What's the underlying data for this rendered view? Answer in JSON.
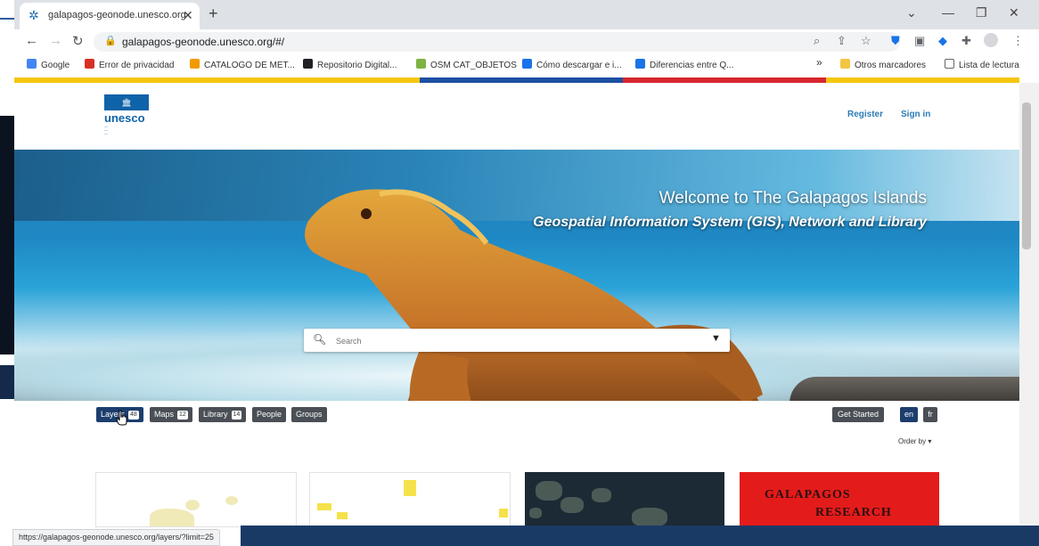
{
  "browser": {
    "tab_title": "galapagos-geonode.unesco.org",
    "new_tab_icon": "+",
    "url": "galapagos-geonode.unesco.org/#/",
    "status_url": "https://galapagos-geonode.unesco.org/layers/?limit=25",
    "bookmarks": [
      {
        "label": "Google",
        "color": "#4285f4"
      },
      {
        "label": "Error de privacidad",
        "color": "#d93025"
      },
      {
        "label": "CATALOGO DE MET...",
        "color": "#f29900"
      },
      {
        "label": "Repositorio Digital...",
        "color": "#202124"
      },
      {
        "label": "OSM CAT_OBJETOS",
        "color": "#7cb342"
      },
      {
        "label": "Cómo descargar e i...",
        "color": "#1a73e8"
      },
      {
        "label": "Diferencias entre Q...",
        "color": "#1a73e8"
      }
    ],
    "bookmarks_overflow": "»",
    "other_bookmarks": "Otros marcadores",
    "reading_list": "Lista de lectura"
  },
  "site": {
    "logo_word": "unesco",
    "register": "Register",
    "sign_in": "Sign in",
    "hero_title": "Welcome to The Galapagos Islands",
    "hero_subtitle": "Geospatial Information System (GIS), Network and Library",
    "search_placeholder": "Search",
    "pills": {
      "layers": "Layers",
      "layers_count": "48",
      "maps": "Maps",
      "maps_count": "12",
      "library": "Library",
      "library_count": "14",
      "people": "People",
      "groups": "Groups"
    },
    "get_started": "Get Started",
    "lang_en": "en",
    "lang_fr": "fr",
    "order_by": "Order by ▾",
    "card4_line1": "GALAPAGOS",
    "card4_line2": "RESEARCH"
  },
  "colors": {
    "stripe": [
      "#f4c70f",
      "#f4c70f",
      "#1d4fa3",
      "#d6262d",
      "#f4c70f"
    ],
    "active_pill": "#1c3e6e",
    "pill": "#4a4f55"
  }
}
